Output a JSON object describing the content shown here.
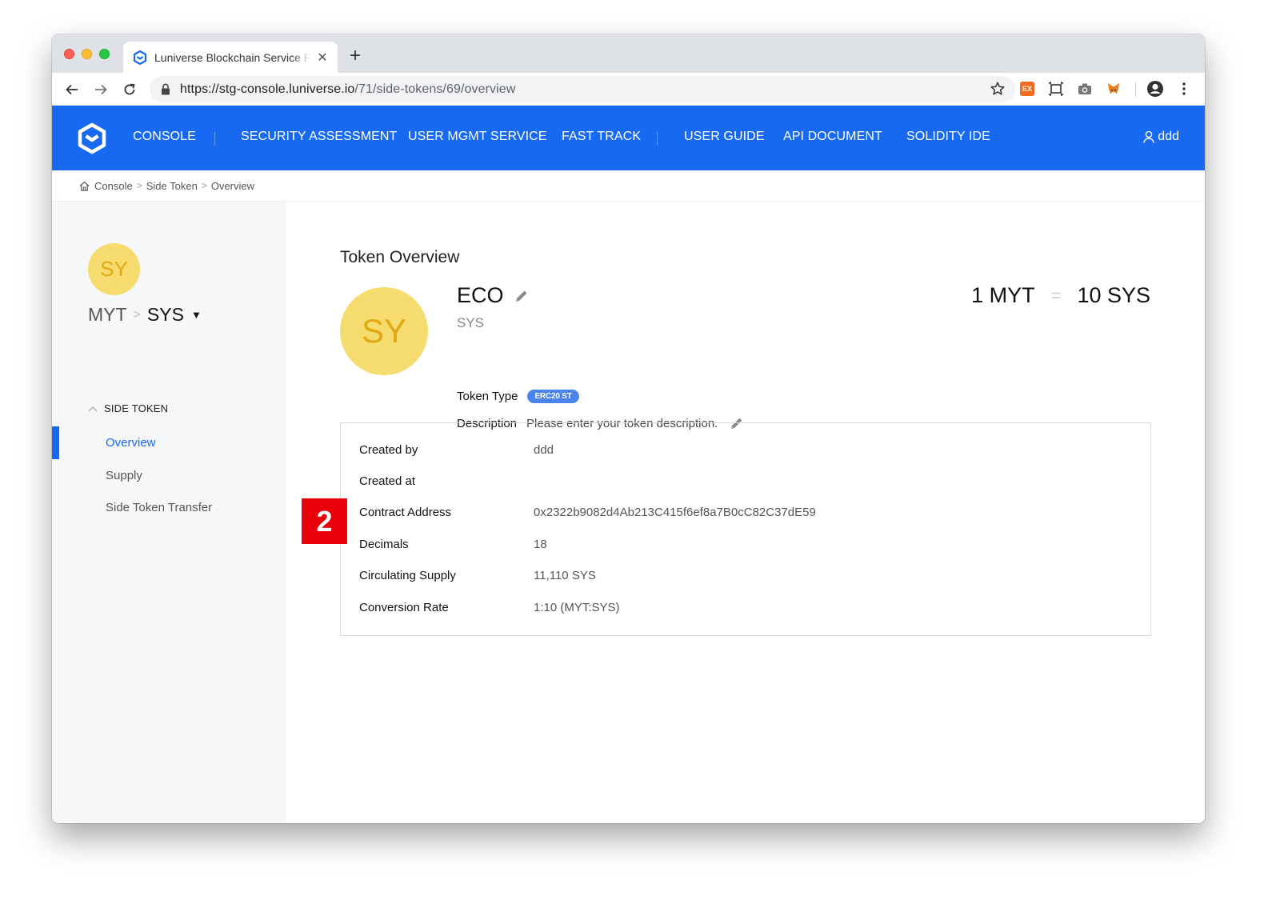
{
  "browser": {
    "tab_title": "Luniverse Blockchain Service P",
    "url_host": "https://stg-console.luniverse.io",
    "url_path": "/71/side-tokens/69/overview",
    "extension_badge": "EX"
  },
  "header": {
    "nav": {
      "console": "CONSOLE",
      "security": "SECURITY ASSESSMENT",
      "user_mgmt": "USER MGMT SERVICE",
      "fast_track": "FAST TRACK",
      "user_guide": "USER GUIDE",
      "api_doc": "API DOCUMENT",
      "solidity_ide": "SOLIDITY IDE"
    },
    "user": "ddd",
    "brand_color": "#1669f0"
  },
  "breadcrumb": {
    "items": [
      "Console",
      "Side Token",
      "Overview"
    ]
  },
  "sidebar": {
    "avatar_initials": "SY",
    "path_from": "MYT",
    "path_to": "SYS",
    "section_label": "SIDE TOKEN",
    "items": [
      "Overview",
      "Supply",
      "Side Token Transfer"
    ],
    "active_index": 0
  },
  "main": {
    "title": "Token Overview",
    "avatar_initials": "SY",
    "token_name": "ECO",
    "token_symbol": "SYS",
    "rate": {
      "left": "1 MYT",
      "equals": "=",
      "right": "10 SYS"
    },
    "token_type_label": "Token Type",
    "token_type_badge": "ERC20 ST",
    "description_label": "Description",
    "description_placeholder": "Please enter your token description.",
    "details": [
      {
        "key": "Created by",
        "value": "ddd"
      },
      {
        "key": "Created at",
        "value": ""
      },
      {
        "key": "Contract Address",
        "value": "0x2322b9082d4Ab213C415f6ef8a7B0cC82C37dE59"
      },
      {
        "key": "Decimals",
        "value": "18"
      },
      {
        "key": "Circulating Supply",
        "value": "11,110 SYS"
      },
      {
        "key": "Conversion Rate",
        "value": "1:10 (MYT:SYS)"
      }
    ]
  },
  "annotation": {
    "step": "2",
    "color": "#e8000b"
  }
}
